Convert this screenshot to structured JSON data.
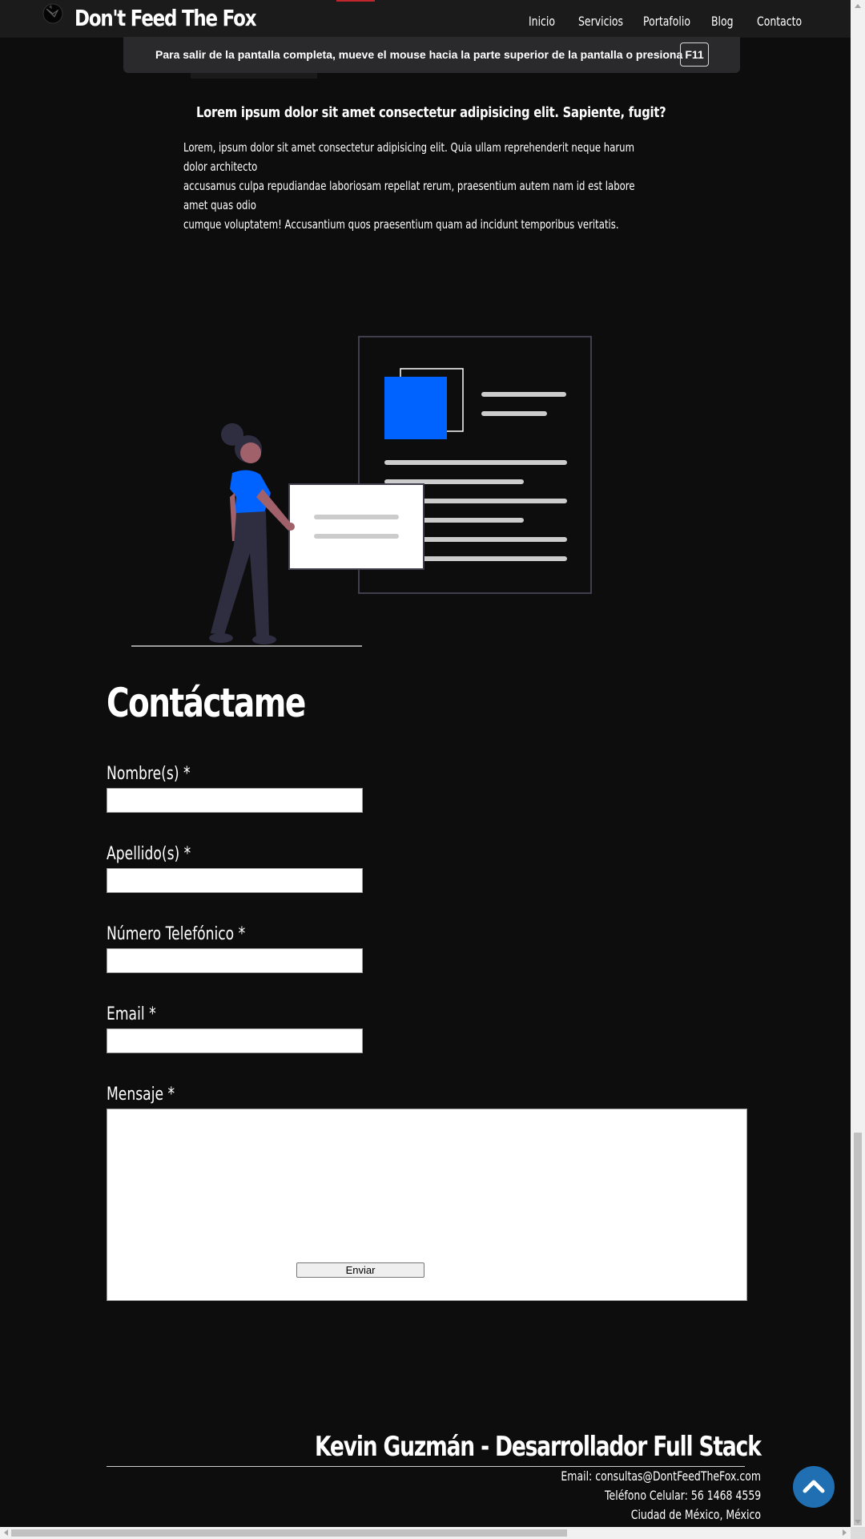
{
  "header": {
    "brand": "Don't Feed The Fox",
    "nav": [
      "Inicio",
      "Servicios",
      "Portafolio",
      "Blog",
      "Contacto"
    ]
  },
  "fullscreen_notice": {
    "text": "Para salir de la pantalla completa, mueve el mouse hacia la parte superior de la pantalla o presiona",
    "key": "F11"
  },
  "article": {
    "title": "Lorem ipsum dolor sit amet consectetur adipisicing elit. Sapiente, fugit?",
    "body_lines": [
      "Lorem, ipsum dolor sit amet consectetur adipisicing elit. Quia ullam reprehenderit neque harum dolor architecto",
      "accusamus culpa repudiandae laboriosam repellat rerum, praesentium autem nam id est labore amet quas odio",
      "cumque voluptatem! Accusantium quos praesentium quam ad incidunt temporibus veritatis."
    ]
  },
  "contact": {
    "title": "Contáctame",
    "fields": {
      "first_name": {
        "label": "Nombre(s) *",
        "value": ""
      },
      "last_name": {
        "label": "Apellido(s) *",
        "value": ""
      },
      "phone": {
        "label": "Número Telefónico *",
        "value": ""
      },
      "email": {
        "label": "Email *",
        "value": ""
      },
      "message": {
        "label": "Mensaje *",
        "value": ""
      }
    },
    "submit_label": "Enviar"
  },
  "footer": {
    "title": "Kevin Guzmán - Desarrollador Full Stack",
    "email": "Email: consultas@DontFeedTheFox.com",
    "phone": "Teléfono Celular: 56 1468 4559",
    "location": "Ciudad de México, México"
  },
  "colors": {
    "background": "#0d0d0e",
    "header": "#1b1b1c",
    "accent_blue": "#0063ff",
    "scroll_button": "#1f6fb2"
  },
  "icons": {
    "logo": "fox-logo-icon",
    "scroll_top": "chevron-up-icon"
  }
}
